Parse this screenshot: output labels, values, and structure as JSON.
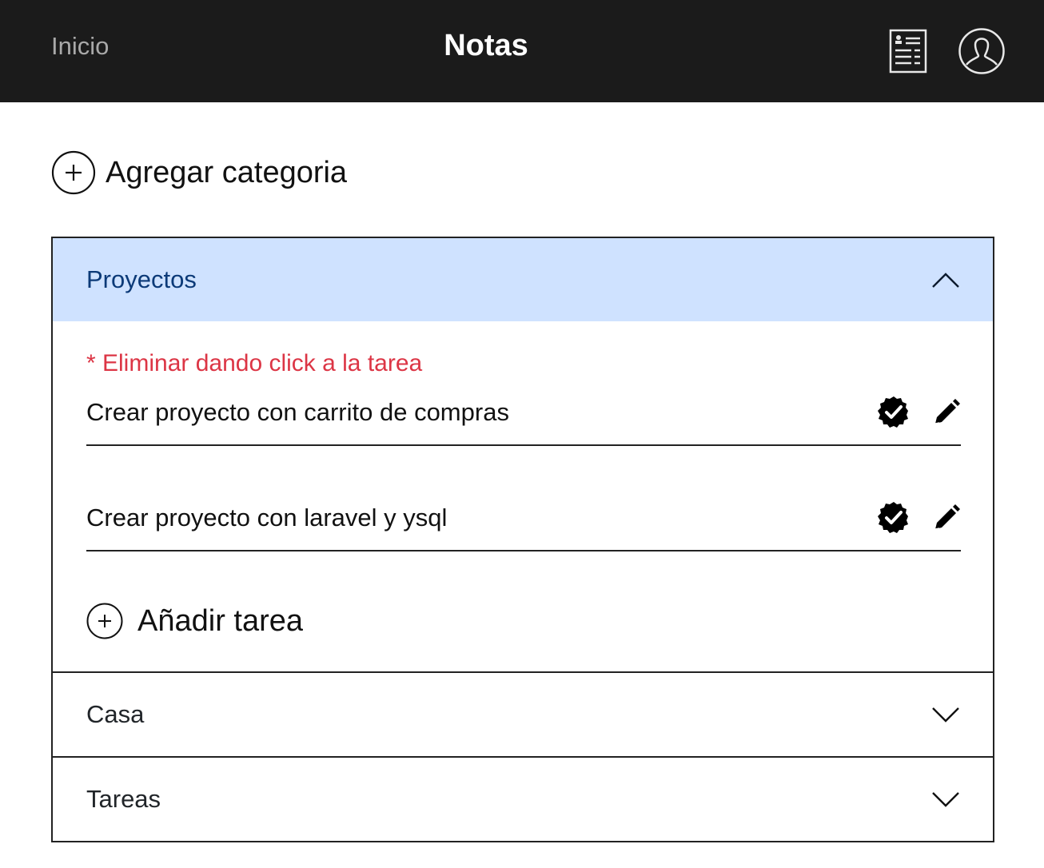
{
  "nav": {
    "home_link": "Inicio",
    "brand": "Notas",
    "notes_icon": "notes-list-icon",
    "user_icon": "user-profile-icon"
  },
  "add_category": {
    "label": "Agregar categoria",
    "icon": "plus-circle-icon"
  },
  "categories": [
    {
      "name": "Proyectos",
      "expanded": true,
      "hint": "* Eliminar dando click a la tarea",
      "tasks": [
        {
          "text": "Crear proyecto con carrito de compras"
        },
        {
          "text": "Crear proyecto con laravel y ysql"
        }
      ],
      "add_task_label": "Añadir tarea"
    },
    {
      "name": "Casa",
      "expanded": false
    },
    {
      "name": "Tareas",
      "expanded": false
    }
  ],
  "colors": {
    "navbar": "#1b1b1b",
    "active_header": "#cfe2ff",
    "active_header_text": "#0c3a78",
    "hint": "#dc3545"
  }
}
